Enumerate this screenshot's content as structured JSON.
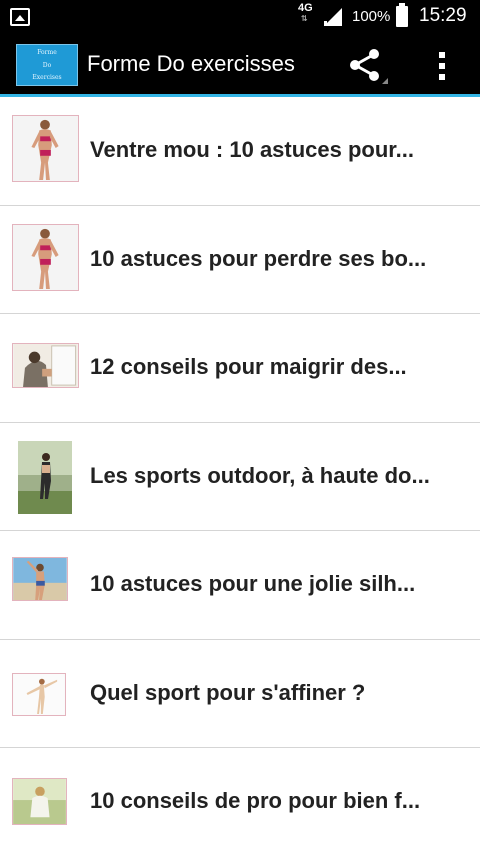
{
  "status_bar": {
    "network": "4G",
    "battery": "100%",
    "time": "15:29",
    "icons": [
      "gallery-icon",
      "signal-icon",
      "battery-icon"
    ]
  },
  "action_bar": {
    "logo_text": [
      "Forme",
      "Do",
      "Exercises"
    ],
    "title": "Forme Do exercisses",
    "icons": [
      "share-icon",
      "overflow-menu-icon"
    ]
  },
  "colors": {
    "accent": "#33b5e5",
    "bar_background": "#000000",
    "logo_background": "#1f9ad6",
    "title_text": "#222222"
  },
  "articles": [
    {
      "title": "Ventre mou : 10 astuces pour...",
      "thumb": "woman-bikini-photo"
    },
    {
      "title": "10 astuces pour perdre ses bo...",
      "thumb": "woman-bikini-photo"
    },
    {
      "title": "12 conseils pour maigrir des...",
      "thumb": "woman-window-photo"
    },
    {
      "title": "Les sports outdoor, à haute do...",
      "thumb": "woman-running-outdoor-photo"
    },
    {
      "title": "10 astuces pour une jolie silh...",
      "thumb": "woman-beach-photo"
    },
    {
      "title": "Quel sport pour s'affiner ?",
      "thumb": "woman-stretching-photo"
    },
    {
      "title": "10 conseils de pro pour bien f...",
      "thumb": "woman-lawn-photo"
    }
  ]
}
